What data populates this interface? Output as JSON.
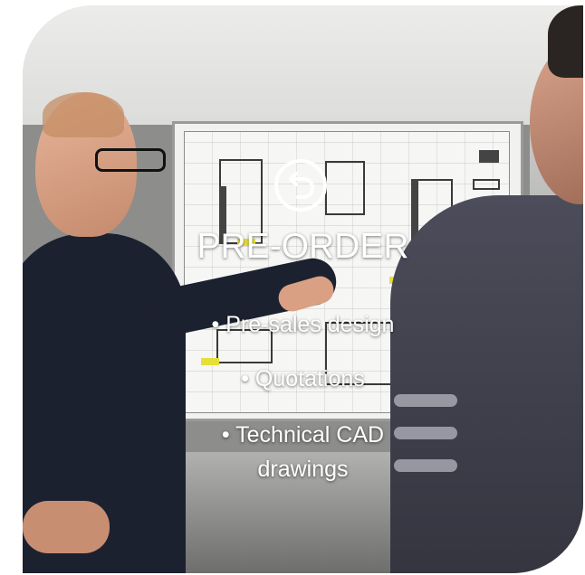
{
  "card": {
    "icon": "undo-arrow-icon",
    "title": "PRE-ORDER",
    "items": [
      {
        "label": "• Pre-sales design"
      },
      {
        "label": "• Quotations"
      },
      {
        "label_line1": "• Technical CAD",
        "label_line2": "drawings"
      }
    ]
  },
  "colors": {
    "text": "#ffffff",
    "overlay": "#000000"
  }
}
